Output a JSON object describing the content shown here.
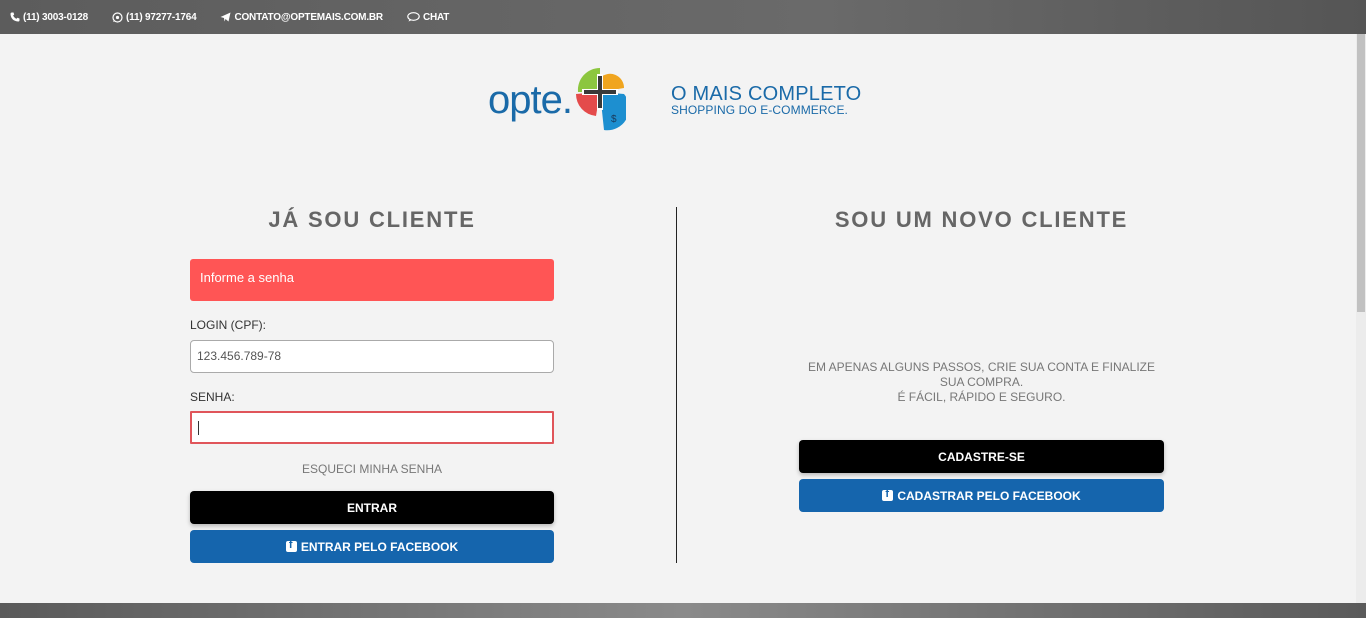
{
  "topbar": {
    "phone": "(11) 3003-0128",
    "whatsapp": "(11) 97277-1764",
    "email": "CONTATO@OPTEMAIS.COM.BR",
    "chat": "CHAT"
  },
  "brand": {
    "logo_text": "opte.",
    "tagline_main": "O MAIS COMPLETO",
    "tagline_sub": "SHOPPING DO E-COMMERCE.",
    "color": "#1a6aa8"
  },
  "login": {
    "heading": "JÁ SOU CLIENTE",
    "alert": "Informe a senha",
    "login_label": "LOGIN (CPF):",
    "login_value": "123.456.789-78",
    "password_label": "SENHA:",
    "password_value": "",
    "forgot": "ESQUECI MINHA SENHA",
    "submit": "ENTRAR",
    "facebook": "ENTRAR PELO FACEBOOK"
  },
  "register": {
    "heading": "SOU UM NOVO CLIENTE",
    "text_line1": "EM APENAS ALGUNS PASSOS, CRIE SUA CONTA E FINALIZE SUA COMPRA.",
    "text_line2": "É FÁCIL, RÁPIDO E SEGURO.",
    "submit": "CADASTRE-SE",
    "facebook": "CADASTRAR PELO FACEBOOK"
  },
  "colors": {
    "alert": "#ff5555",
    "facebook": "#1565ad",
    "error_border": "#e0555a"
  }
}
